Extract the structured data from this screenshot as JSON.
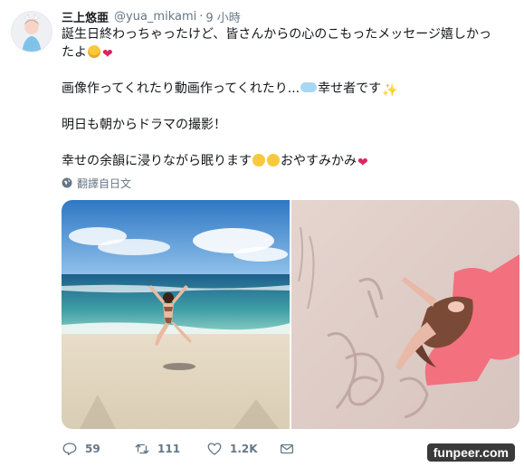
{
  "user": {
    "display_name": "三上悠亜",
    "handle": "@yua_mikami",
    "separator": "·",
    "time": "9 小時"
  },
  "tweet": {
    "line1": "誕生日終わっちゃったけど、皆さんからの心のこもったメッセージ嬉しかっ",
    "line2": "たよ",
    "line3": "画像作ってくれたり動画作ってくれたり...",
    "line3_suffix": "幸せ者です",
    "line4": "明日も朝からドラマの撮影！",
    "line5": "幸せの余韻に浸りながら眠ります",
    "line5_suffix": "おやすみかみ"
  },
  "translate_label": "翻譯自日文",
  "actions": {
    "reply_count": "59",
    "retweet_count": "111",
    "like_count": "1.2K"
  },
  "watermark": "funpeer.com",
  "icons": [
    "reply-icon",
    "retweet-icon",
    "like-icon",
    "dm-icon",
    "globe-icon"
  ],
  "colors": {
    "text": "#14171a",
    "secondary": "#657786",
    "heart": "#e0245e"
  }
}
